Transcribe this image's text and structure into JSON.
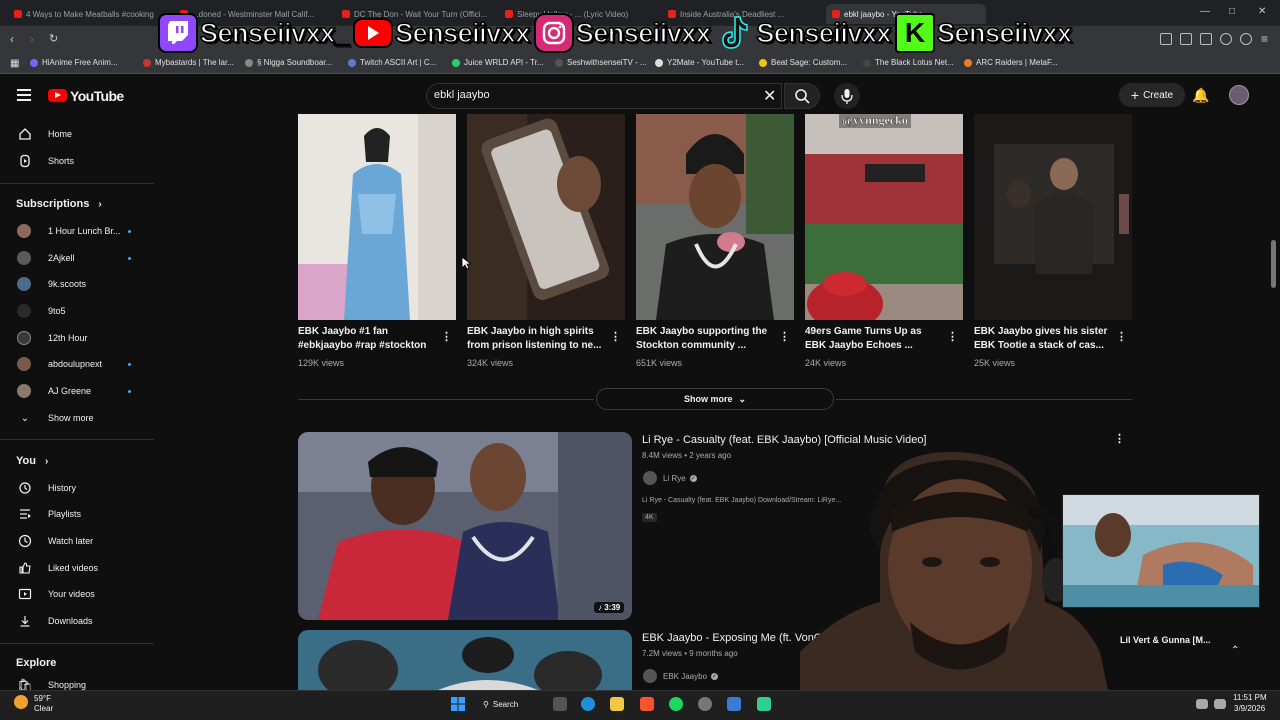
{
  "browser": {
    "tabs": [
      "4 Ways to Make Meatballs #cooking",
      "...doned - Westminster Mall Calif...",
      "DC The Don - Wait Your Turn (Offici...",
      "Sleepy Hallow - ... (Lyric Video)",
      "Inside Australia's Deadliest ...",
      "ebkl jaaybo - YouTube"
    ],
    "bookmarks": [
      "HiAnime Free Anim...",
      "Mybastards | The lar...",
      "§ Nigga Soundboar...",
      "Twitch ASCII Art | C...",
      "Juice WRLD API - Tr...",
      "SeshwithsenseiTV - ...",
      "Y2Mate - YouTube t...",
      "Beat Sage: Custom...",
      "The Black Lotus Net...",
      "ARC Raiders | MetaF..."
    ]
  },
  "banner": {
    "items": [
      {
        "platform": "twitch-icon",
        "name": "Senseiivxx_",
        "color": "#9146ff"
      },
      {
        "platform": "youtube-icon",
        "name": "Senseiivxx",
        "color": "#ff0000"
      },
      {
        "platform": "instagram-icon",
        "name": "Senseiivxx",
        "color": "#d62976"
      },
      {
        "platform": "tiktok-icon",
        "name": "Senseiivxx",
        "color": "#000000"
      },
      {
        "platform": "kick-icon",
        "name": "Senseiivxx",
        "color": "#53fc18"
      }
    ]
  },
  "youtube": {
    "logo_text": "YouTube",
    "search_value": "ebkl jaaybo",
    "create_label": "Create"
  },
  "sidebar": {
    "main": [
      {
        "icon": "home-icon",
        "label": "Home"
      },
      {
        "icon": "shorts-icon",
        "label": "Shorts"
      }
    ],
    "subscriptions_header": "Subscriptions",
    "subscriptions": [
      {
        "label": "1 Hour Lunch Br...",
        "dot": true,
        "color": "#8a6b5a"
      },
      {
        "label": "2Ajkell",
        "dot": true,
        "color": "#5a5a5a"
      },
      {
        "label": "9k.scoots",
        "dot": false,
        "color": "#4a6b8a"
      },
      {
        "label": "9to5",
        "dot": false,
        "color": "#2a2a2a"
      },
      {
        "label": "12th Hour",
        "dot": false,
        "color": "#3a3a3a"
      },
      {
        "label": "abdoulupnext",
        "dot": true,
        "color": "#7a5a4a"
      },
      {
        "label": "AJ Greene",
        "dot": true,
        "color": "#8a7a6a"
      }
    ],
    "show_more": "Show more",
    "you_header": "You",
    "you": [
      {
        "icon": "history-icon",
        "label": "History"
      },
      {
        "icon": "playlists-icon",
        "label": "Playlists"
      },
      {
        "icon": "watch-later-icon",
        "label": "Watch later"
      },
      {
        "icon": "liked-videos-icon",
        "label": "Liked videos"
      },
      {
        "icon": "your-videos-icon",
        "label": "Your videos"
      },
      {
        "icon": "downloads-icon",
        "label": "Downloads"
      }
    ],
    "explore_header": "Explore",
    "explore": [
      {
        "icon": "shopping-icon",
        "label": "Shopping"
      }
    ]
  },
  "shorts": [
    {
      "title": "EBK Jaaybo #1 fan #ebkjaaybo #rap #stockton",
      "views": "129K views"
    },
    {
      "title": "EBK Jaaybo in high spirits from prison listening to ne...",
      "views": "324K views"
    },
    {
      "title": "EBK Jaaybo supporting the Stockton community ...",
      "views": "651K views",
      "overlay": ""
    },
    {
      "title": "49ers Game Turns Up as EBK Jaaybo Echoes ...",
      "views": "24K views",
      "overlay": "@yvnngecko"
    },
    {
      "title": "EBK Jaaybo gives his sister EBK Tootie a stack of cas...",
      "views": "25K views"
    }
  ],
  "shorts_show_more": "Show more",
  "videos": [
    {
      "title": "Li Rye - Casualty (feat. EBK Jaaybo) [Official Music Video]",
      "meta": "8.4M views • 2 years ago",
      "channel": "Li Rye",
      "description": "Li Rye - Casualty (feat. EBK Jaaybo) Download/Stream: LiRye...",
      "badge": "4K",
      "duration": "3:39"
    },
    {
      "title": "EBK Jaaybo - Exposing Me (ft. VonOff1700)",
      "meta": "7.2M views • 9 months ago",
      "channel": "EBK Jaaybo"
    }
  ],
  "pip": {
    "label": "Lil Vert & Gunna [M..."
  },
  "taskbar": {
    "weather_temp": "59°F",
    "weather_cond": "Clear",
    "search_label": "Search",
    "time": "11:51 PM",
    "date": "3/9/2026"
  }
}
